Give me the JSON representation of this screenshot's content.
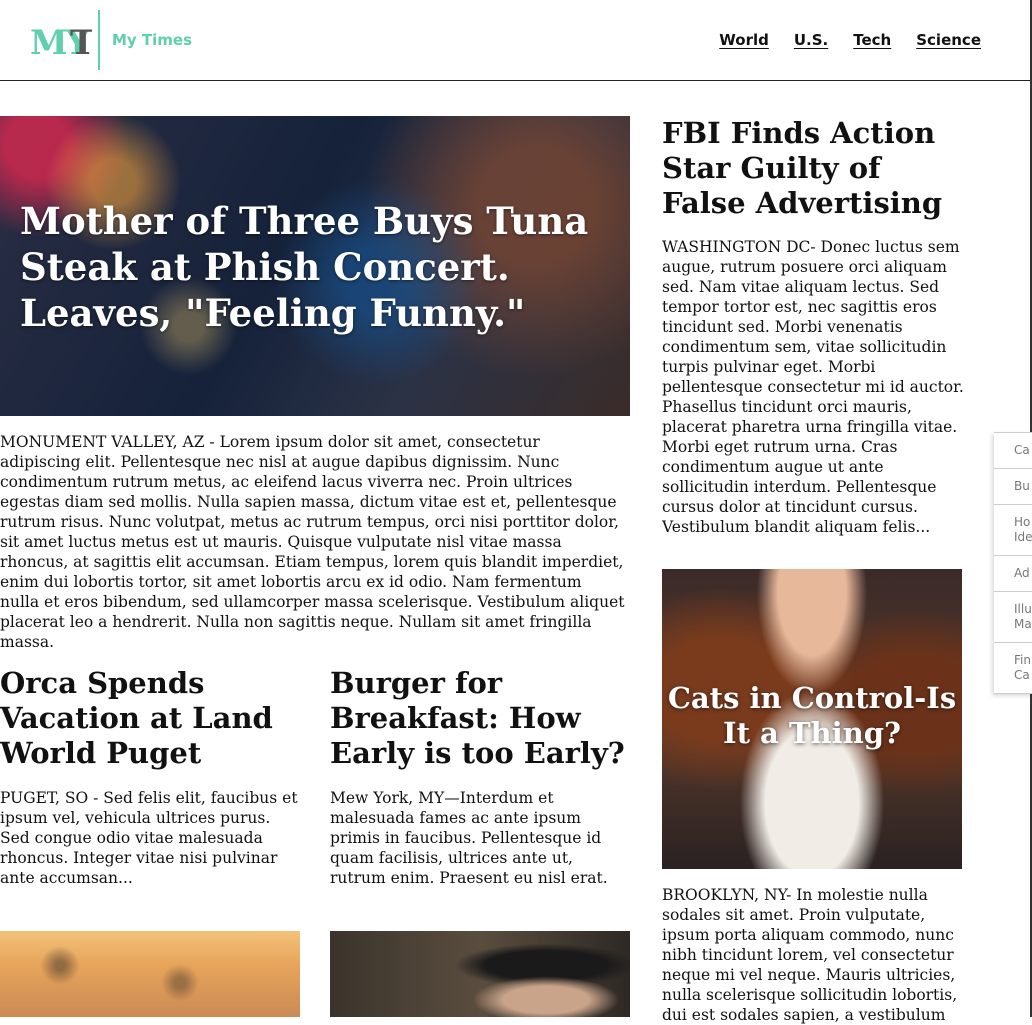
{
  "header": {
    "logo_text": "MYT",
    "site_name": "My Times",
    "nav": [
      "World",
      "U.S.",
      "Tech",
      "Science"
    ]
  },
  "lead": {
    "title": "Mother of Three Buys Tuna Steak at Phish Concert. Leaves, \"Feeling Funny.\"",
    "body": "MONUMENT VALLEY, AZ - Lorem ipsum dolor sit amet, consectetur adipiscing elit. Pellentesque nec nisl at augue dapibus dignissim. Nunc condimentum rutrum metus, ac eleifend lacus viverra nec. Proin ultrices egestas diam sed mollis. Nulla sapien massa, dictum vitae est et, pellentesque rutrum risus. Nunc volutpat, metus ac rutrum tempus, orci nisi porttitor dolor, sit amet luctus metus est ut mauris. Quisque vulputate nisl vitae massa rhoncus, at sagittis elit accumsan. Etiam tempus, lorem quis blandit imperdiet, enim dui lobortis tortor, sit amet lobortis arcu ex id odio. Nam fermentum nulla et eros bibendum, sed ullamcorper massa scelerisque. Vestibulum aliquet placerat leo a hendrerit. Nulla non sagittis neque. Nullam sit amet fringilla massa."
  },
  "orca": {
    "title": "Orca Spends Vacation at Land World Puget",
    "body": "PUGET, SO - Sed felis elit, faucibus et ipsum vel, vehicula ultrices purus. Sed congue odio vitae malesuada rhoncus. Integer vitae nisi pulvinar ante accumsan..."
  },
  "burger": {
    "title": "Burger for Breakfast: How Early is too Early?",
    "body": "Mew York, MY—Interdum et malesuada fames ac ante ipsum primis in faucibus. Pellentesque id quam facilisis, ultrices ante ut, rutrum enim. Praesent eu nisl erat."
  },
  "fbi": {
    "title": "FBI Finds Action Star Guilty of False Advertising",
    "body": "WASHINGTON DC- Donec luctus sem augue, rutrum posuere orci aliquam sed. Nam vitae aliquam lectus. Sed tempor tortor est, nec sagittis eros tincidunt sed. Morbi venenatis condimentum sem, vitae sollicitudin turpis pulvinar eget. Morbi pellentesque consectetur mi id auctor. Phasellus tincidunt orci mauris, placerat pharetra urna fringilla vitae. Morbi eget rutrum urna. Cras condimentum augue ut ante sollicitudin interdum. Pellentesque cursus dolor at tincidunt cursus. Vestibulum blandit aliquam felis..."
  },
  "cats": {
    "title": "Cats in Control-Is It a Thing?",
    "body": "BROOKLYN, NY- In molestie nulla sodales sit amet. Proin vulputate, ipsum porta aliquam commodo, nunc nibh tincidunt lorem, vel consectetur neque mi vel neque. Mauris ultricies, nulla scelerisque sollicitudin lobortis, dui est sodales sapien, a vestibulum"
  },
  "side_menu": [
    "Ca",
    "Bu",
    "Ho\nIde",
    "Ad",
    "Illu\nMa",
    "Fin\nCa"
  ],
  "colors": {
    "brand": "#5fcfae",
    "text": "#111111"
  }
}
